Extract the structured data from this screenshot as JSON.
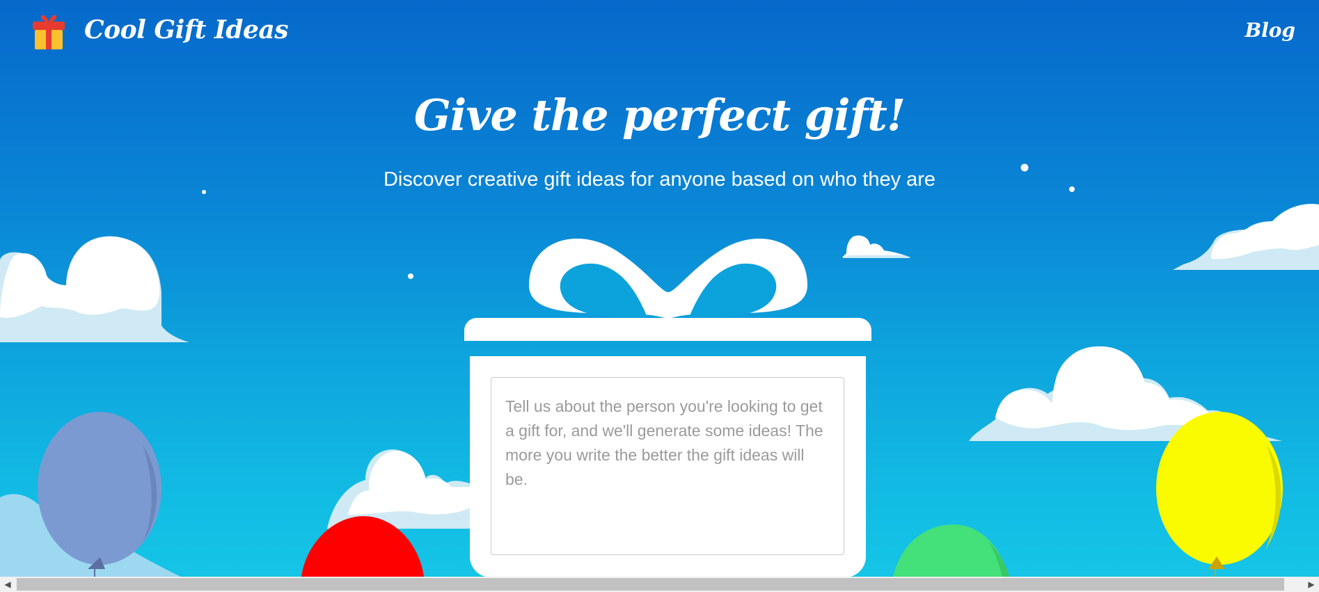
{
  "header": {
    "brand": "Cool Gift Ideas",
    "nav_blog": "Blog"
  },
  "hero": {
    "title": "Give the perfect gift!",
    "subtitle": "Discover creative gift ideas for anyone based on who they are"
  },
  "gift_form": {
    "input_value": "",
    "placeholder": "Tell us about the person you're looking to get a gift for, and we'll generate some ideas! The more you write the better the gift ideas will be."
  },
  "decor": {
    "balloon_colors": [
      "#7b9ad2",
      "#ff0000",
      "#44e07a",
      "#fbfb00"
    ],
    "cloud_color": "#ffffff",
    "cloud_shadow": "#cfeaf4"
  },
  "icons": {
    "logo": "gift-icon",
    "scroll_left": "arrow-left-icon",
    "scroll_right": "arrow-right-icon"
  }
}
